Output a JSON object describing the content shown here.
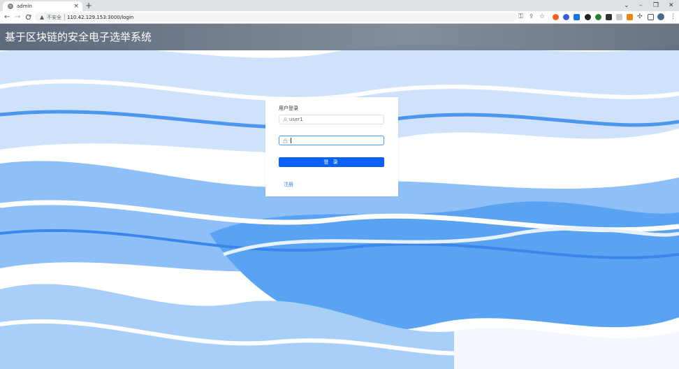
{
  "browser": {
    "tab_title": "admin",
    "tab_close": "×",
    "new_tab": "+",
    "security_label": "不安全",
    "url": "110.42.129.153:3000/login",
    "window_controls": {
      "menu": "⌄",
      "minimize": "–",
      "restore": "❐",
      "close": "✕"
    },
    "nav": {
      "back": "←",
      "forward": "→",
      "reload": "C"
    }
  },
  "header": {
    "title": "基于区块链的安全电子选举系统"
  },
  "login": {
    "title": "用户登录",
    "username_value": "user1",
    "password_mask": "·",
    "submit_label": "登 录",
    "register_link": "注册"
  },
  "colors": {
    "accent": "#0a60f5",
    "link": "#3a7cf0",
    "focus_border": "#409eff"
  }
}
